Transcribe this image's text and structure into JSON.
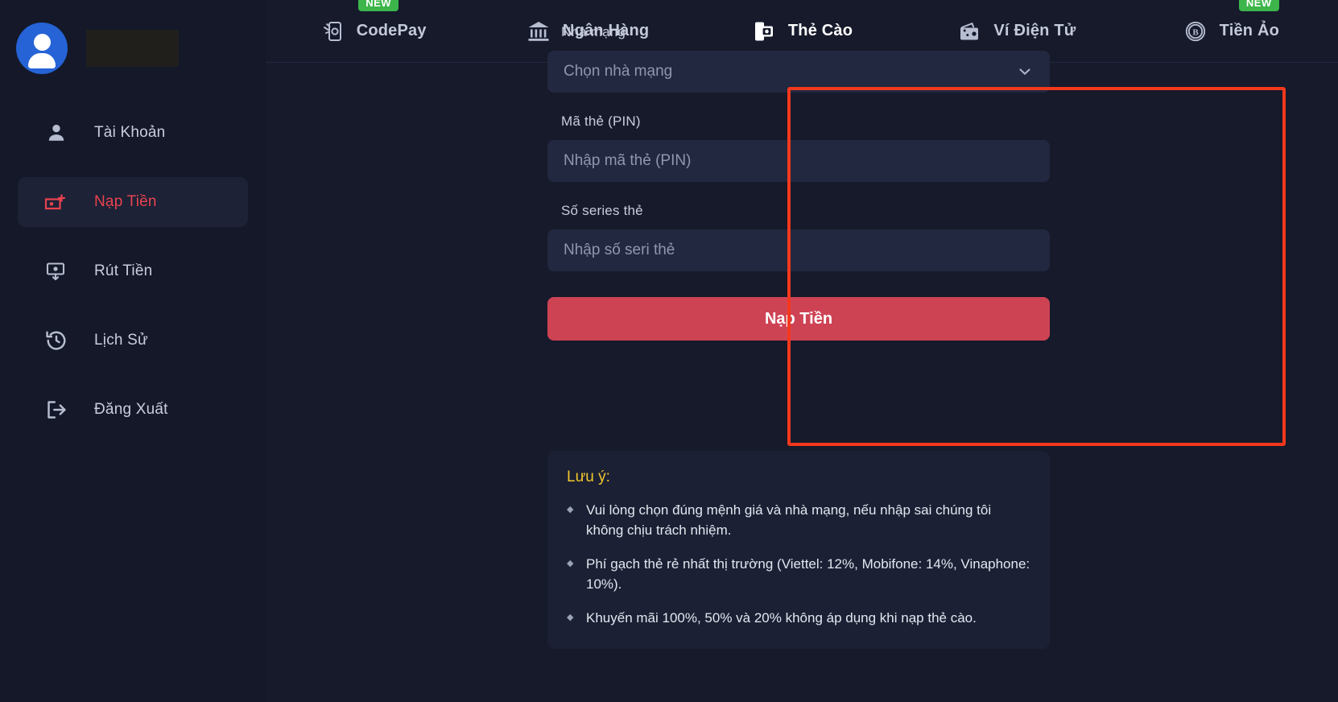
{
  "sidebar": {
    "profile": {
      "username_redacted": true
    },
    "items": [
      {
        "label": "Tài Khoản",
        "icon": "user-icon",
        "active": false
      },
      {
        "label": "Nạp Tiền",
        "icon": "money-plus-icon",
        "active": true
      },
      {
        "label": "Rút Tiền",
        "icon": "money-down-icon",
        "active": false
      },
      {
        "label": "Lịch Sử",
        "icon": "history-clock-icon",
        "active": false
      },
      {
        "label": "Đăng Xuất",
        "icon": "logout-icon",
        "active": false
      }
    ]
  },
  "tabs": [
    {
      "label": "CodePay",
      "icon": "phone-scan-icon",
      "badge": "NEW",
      "active": false
    },
    {
      "label": "Ngân Hàng",
      "icon": "bank-icon",
      "badge": "",
      "active": false
    },
    {
      "label": "Thẻ Cào",
      "icon": "prepaid-card-icon",
      "badge": "",
      "active": true
    },
    {
      "label": "Ví Điện Tử",
      "icon": "wallet-icon",
      "badge": "",
      "active": false
    },
    {
      "label": "Tiền Ảo",
      "icon": "bitcoin-icon",
      "badge": "NEW",
      "active": false
    }
  ],
  "form": {
    "provider": {
      "label": "Nhà mạng",
      "placeholder": "Chọn nhà mạng",
      "value": ""
    },
    "pin": {
      "label": "Mã thẻ (PIN)",
      "placeholder": "Nhập mã thẻ (PIN)",
      "value": ""
    },
    "serial": {
      "label": "Số series thẻ",
      "placeholder": "Nhập số seri thẻ",
      "value": ""
    },
    "submit_label": "Nạp Tiền"
  },
  "notes": {
    "title": "Lưu ý:",
    "items": [
      "Vui lòng chọn đúng mệnh giá và nhà mạng, nếu nhập sai chúng tôi không chịu trách nhiệm.",
      "Phí gạch thẻ rẻ nhất thị trường (Viettel: 12%, Mobifone: 14%, Vinaphone: 10%).",
      "Khuyến mãi 100%, 50% và 20% không áp dụng khi nạp thẻ cào."
    ],
    "bullet_glyph": "◆"
  },
  "colors": {
    "accent_red": "#ce4354",
    "active_tab_underline": "#2b7ff0",
    "badge_green": "#3cb54a",
    "note_title_yellow": "#f2c82e",
    "annotation_red": "#f4381d",
    "sidebar_bg": "#141828",
    "main_bg": "#161a2b",
    "input_bg": "#222840"
  }
}
